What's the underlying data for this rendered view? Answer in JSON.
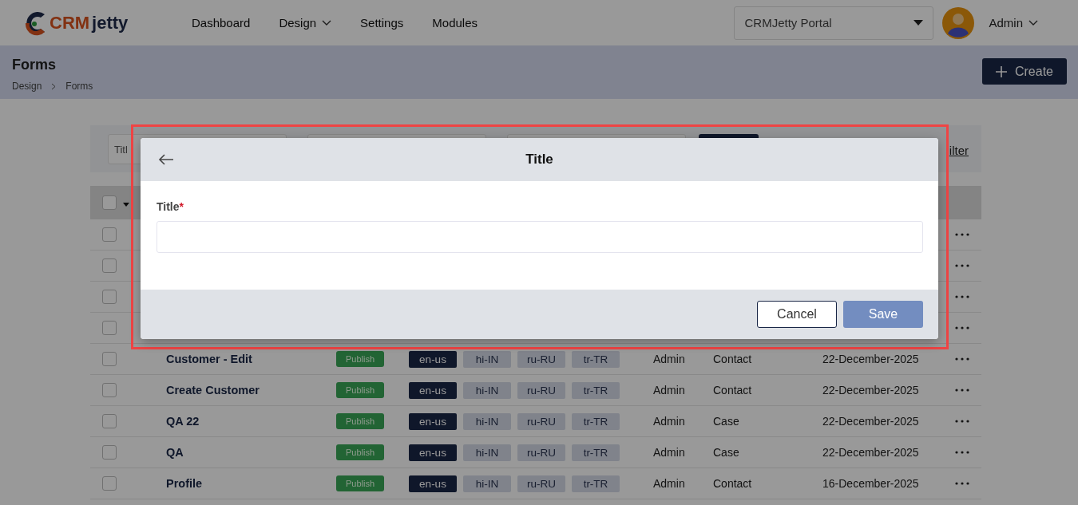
{
  "logo": {
    "prefix": "CRM",
    "suffix": "jetty"
  },
  "nav": [
    {
      "label": "Dashboard",
      "dropdown": false
    },
    {
      "label": "Design",
      "dropdown": true
    },
    {
      "label": "Settings",
      "dropdown": false
    },
    {
      "label": "Modules",
      "dropdown": false
    }
  ],
  "portal_select": {
    "value": "CRMJetty Portal"
  },
  "user": {
    "name": "Admin"
  },
  "page": {
    "title": "Forms",
    "breadcrumb": [
      "Design",
      "Forms"
    ],
    "create_button": "Create"
  },
  "filters": {
    "title_placeholder": "Titl",
    "filter_link": "ilter"
  },
  "table": {
    "header_checked": false,
    "rows": [
      {
        "checked": false
      },
      {
        "checked": false
      },
      {
        "checked": false
      },
      {
        "checked": false
      },
      {
        "checked": false,
        "title": "Customer - Edit",
        "status": "Publish",
        "languages": [
          {
            "label": "en-us",
            "selected": true
          },
          {
            "label": "hi-IN",
            "selected": false
          },
          {
            "label": "ru-RU",
            "selected": false
          },
          {
            "label": "tr-TR",
            "selected": false
          }
        ],
        "owner": "Admin",
        "entity": "Contact",
        "created": "22-December-2025"
      },
      {
        "checked": false,
        "title": "Create Customer",
        "status": "Publish",
        "languages": [
          {
            "label": "en-us",
            "selected": true
          },
          {
            "label": "hi-IN",
            "selected": false
          },
          {
            "label": "ru-RU",
            "selected": false
          },
          {
            "label": "tr-TR",
            "selected": false
          }
        ],
        "owner": "Admin",
        "entity": "Contact",
        "created": "22-December-2025"
      },
      {
        "checked": false,
        "title": "QA 22",
        "status": "Publish",
        "languages": [
          {
            "label": "en-us",
            "selected": true
          },
          {
            "label": "hi-IN",
            "selected": false
          },
          {
            "label": "ru-RU",
            "selected": false
          },
          {
            "label": "tr-TR",
            "selected": false
          }
        ],
        "owner": "Admin",
        "entity": "Case",
        "created": "22-December-2025"
      },
      {
        "checked": false,
        "title": "QA",
        "status": "Publish",
        "languages": [
          {
            "label": "en-us",
            "selected": true
          },
          {
            "label": "hi-IN",
            "selected": false
          },
          {
            "label": "ru-RU",
            "selected": false
          },
          {
            "label": "tr-TR",
            "selected": false
          }
        ],
        "owner": "Admin",
        "entity": "Case",
        "created": "22-December-2025"
      },
      {
        "checked": false,
        "title": "Profile",
        "status": "Publish",
        "languages": [
          {
            "label": "en-us",
            "selected": true
          },
          {
            "label": "hi-IN",
            "selected": false
          },
          {
            "label": "ru-RU",
            "selected": false
          },
          {
            "label": "tr-TR",
            "selected": false
          }
        ],
        "owner": "Admin",
        "entity": "Contact",
        "created": "16-December-2025"
      }
    ]
  },
  "modal": {
    "title": "Title",
    "field_label": "Title",
    "required_mark": "*",
    "cancel": "Cancel",
    "save": "Save",
    "save_disabled": true
  }
}
